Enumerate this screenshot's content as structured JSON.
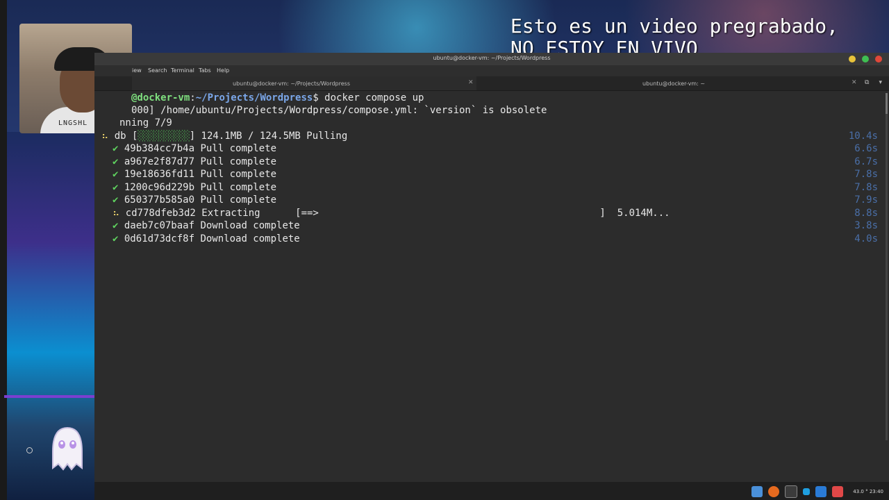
{
  "overlay": {
    "line1": "Esto es un video pregrabado,",
    "line2": "NO ESTOY EN VIVO"
  },
  "webcam": {
    "shirt_text": "LNGSHL"
  },
  "window": {
    "title": "ubuntu@docker-vm: ~/Projects/Wordpress"
  },
  "menu": {
    "view": "iew",
    "search": "Search",
    "terminal": "Terminal",
    "tabs": "Tabs",
    "help": "Help"
  },
  "tabs": [
    {
      "label": "ubuntu@docker-vm: ~/Projects/Wordpress",
      "active": true
    },
    {
      "label": "ubuntu@docker-vm: ~",
      "active": false
    }
  ],
  "terminal": {
    "prompt_host": "@docker-vm",
    "prompt_sep": ":",
    "prompt_path": "~/Projects/Wordpress",
    "prompt_dollar": "$ ",
    "command": "docker compose up",
    "warn_line": "000] /home/ubuntu/Projects/Wordpress/compose.yml: `version` is obsolete",
    "running_line": "nning 7/9",
    "pull_prefix": "db [",
    "pull_bar": "░░░░░░░░░░",
    "pull_suffix": "] 124.1MB / 124.5MB Pulling",
    "pull_time": "10.4s",
    "layers": [
      {
        "icon": "✔",
        "state": "done",
        "text": "49b384cc7b4a Pull complete",
        "time": "6.6s"
      },
      {
        "icon": "✔",
        "state": "done",
        "text": "a967e2f87d77 Pull complete",
        "time": "6.7s"
      },
      {
        "icon": "✔",
        "state": "done",
        "text": "19e18636fd11 Pull complete",
        "time": "7.8s"
      },
      {
        "icon": "✔",
        "state": "done",
        "text": "1200c96d229b Pull complete",
        "time": "7.8s"
      },
      {
        "icon": "✔",
        "state": "done",
        "text": "650377b585a0 Pull complete",
        "time": "7.9s"
      },
      {
        "icon": "⠦",
        "state": "progress",
        "text": "cd778dfeb3d2 Extracting      [==>                                                ]  5.014M...",
        "time": "8.8s"
      },
      {
        "icon": "✔",
        "state": "done",
        "text": "daeb7c07baaf Download complete",
        "time": "3.8s"
      },
      {
        "icon": "✔",
        "state": "done",
        "text": "0d61d73dcf8f Download complete",
        "time": "4.0s"
      }
    ]
  },
  "taskbar": {
    "clock": "43.0 °  23:40"
  },
  "colors": {
    "close": "#e0483a",
    "maximize": "#3fbe52",
    "minimize": "#e8c33a"
  },
  "icons": [
    "files-icon",
    "firefox-icon",
    "terminal-icon",
    "vscode-icon",
    "text-editor-icon"
  ]
}
